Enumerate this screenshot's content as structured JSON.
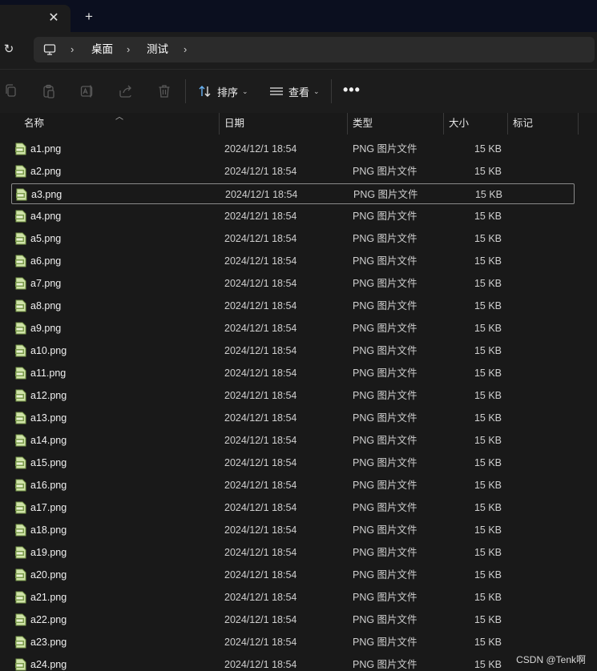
{
  "tabbar": {
    "close_glyph": "✕",
    "new_tab_glyph": "+"
  },
  "address": {
    "refresh_glyph": "↻",
    "breadcrumb": [
      "桌面",
      "测试"
    ],
    "separator_glyph": "›"
  },
  "toolbar": {
    "icons": [
      "copy-icon",
      "paste-icon",
      "rename-icon",
      "share-icon",
      "delete-icon"
    ],
    "sort_label": "排序",
    "view_label": "查看",
    "caret_glyph": "⌄",
    "more_glyph": "•••"
  },
  "columns": {
    "name": "名称",
    "date": "日期",
    "type": "类型",
    "size": "大小",
    "tags": "标记"
  },
  "files": [
    {
      "name": "a1.png",
      "date": "2024/12/1 18:54",
      "type": "PNG 图片文件",
      "size": "15 KB"
    },
    {
      "name": "a2.png",
      "date": "2024/12/1 18:54",
      "type": "PNG 图片文件",
      "size": "15 KB"
    },
    {
      "name": "a3.png",
      "date": "2024/12/1 18:54",
      "type": "PNG 图片文件",
      "size": "15 KB",
      "selected": true
    },
    {
      "name": "a4.png",
      "date": "2024/12/1 18:54",
      "type": "PNG 图片文件",
      "size": "15 KB"
    },
    {
      "name": "a5.png",
      "date": "2024/12/1 18:54",
      "type": "PNG 图片文件",
      "size": "15 KB"
    },
    {
      "name": "a6.png",
      "date": "2024/12/1 18:54",
      "type": "PNG 图片文件",
      "size": "15 KB"
    },
    {
      "name": "a7.png",
      "date": "2024/12/1 18:54",
      "type": "PNG 图片文件",
      "size": "15 KB"
    },
    {
      "name": "a8.png",
      "date": "2024/12/1 18:54",
      "type": "PNG 图片文件",
      "size": "15 KB"
    },
    {
      "name": "a9.png",
      "date": "2024/12/1 18:54",
      "type": "PNG 图片文件",
      "size": "15 KB"
    },
    {
      "name": "a10.png",
      "date": "2024/12/1 18:54",
      "type": "PNG 图片文件",
      "size": "15 KB"
    },
    {
      "name": "a11.png",
      "date": "2024/12/1 18:54",
      "type": "PNG 图片文件",
      "size": "15 KB"
    },
    {
      "name": "a12.png",
      "date": "2024/12/1 18:54",
      "type": "PNG 图片文件",
      "size": "15 KB"
    },
    {
      "name": "a13.png",
      "date": "2024/12/1 18:54",
      "type": "PNG 图片文件",
      "size": "15 KB"
    },
    {
      "name": "a14.png",
      "date": "2024/12/1 18:54",
      "type": "PNG 图片文件",
      "size": "15 KB"
    },
    {
      "name": "a15.png",
      "date": "2024/12/1 18:54",
      "type": "PNG 图片文件",
      "size": "15 KB"
    },
    {
      "name": "a16.png",
      "date": "2024/12/1 18:54",
      "type": "PNG 图片文件",
      "size": "15 KB"
    },
    {
      "name": "a17.png",
      "date": "2024/12/1 18:54",
      "type": "PNG 图片文件",
      "size": "15 KB"
    },
    {
      "name": "a18.png",
      "date": "2024/12/1 18:54",
      "type": "PNG 图片文件",
      "size": "15 KB"
    },
    {
      "name": "a19.png",
      "date": "2024/12/1 18:54",
      "type": "PNG 图片文件",
      "size": "15 KB"
    },
    {
      "name": "a20.png",
      "date": "2024/12/1 18:54",
      "type": "PNG 图片文件",
      "size": "15 KB"
    },
    {
      "name": "a21.png",
      "date": "2024/12/1 18:54",
      "type": "PNG 图片文件",
      "size": "15 KB"
    },
    {
      "name": "a22.png",
      "date": "2024/12/1 18:54",
      "type": "PNG 图片文件",
      "size": "15 KB"
    },
    {
      "name": "a23.png",
      "date": "2024/12/1 18:54",
      "type": "PNG 图片文件",
      "size": "15 KB"
    },
    {
      "name": "a24.png",
      "date": "2024/12/1 18:54",
      "type": "PNG 图片文件",
      "size": "15 KB"
    }
  ],
  "watermark": "CSDN @Tenk啊",
  "colors": {
    "background": "#191919",
    "tabbar": "#0b0f1f",
    "address_bar": "#2b2b2b",
    "file_icon": "#b8d48a"
  }
}
